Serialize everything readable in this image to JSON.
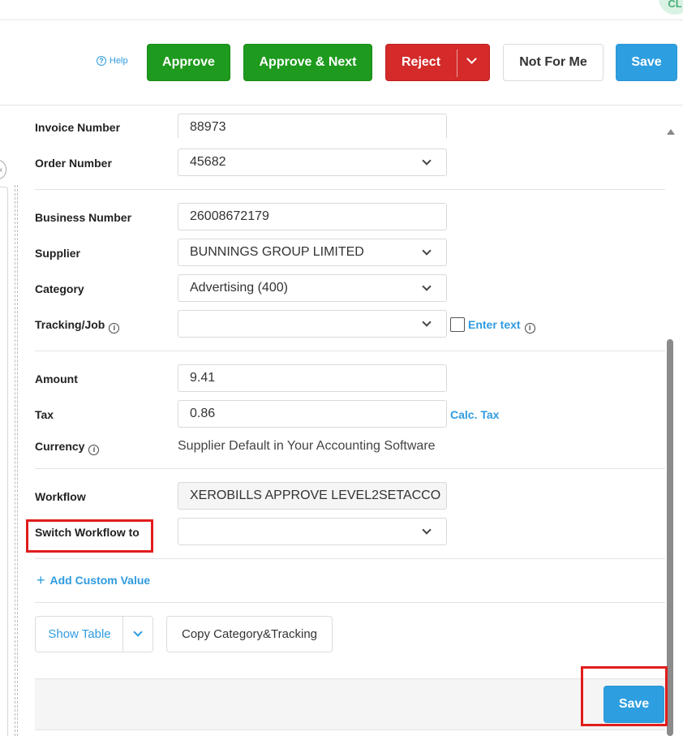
{
  "header": {
    "avatar_initials": "CL"
  },
  "toolbar": {
    "help_label": "Help",
    "approve_label": "Approve",
    "approve_next_label": "Approve & Next",
    "reject_label": "Reject",
    "not_for_me_label": "Not For Me",
    "save_label": "Save"
  },
  "form": {
    "invoice_number": {
      "label": "Invoice Number",
      "value": "88973"
    },
    "order_number": {
      "label": "Order Number",
      "value": "45682"
    },
    "business_number": {
      "label": "Business Number",
      "value": "26008672179"
    },
    "supplier": {
      "label": "Supplier",
      "value": "BUNNINGS GROUP LIMITED"
    },
    "category": {
      "label": "Category",
      "value": "Advertising (400)"
    },
    "tracking": {
      "label": "Tracking/Job",
      "value": "",
      "enter_text_label": "Enter text"
    },
    "amount": {
      "label": "Amount",
      "value": "9.41"
    },
    "tax": {
      "label": "Tax",
      "value": "0.86",
      "calc_label": "Calc. Tax"
    },
    "currency": {
      "label": "Currency",
      "value": "Supplier Default in Your Accounting Software"
    },
    "workflow": {
      "label": "Workflow",
      "value": "XEROBILLS APPROVE LEVEL2SETACCO"
    },
    "switch_workflow": {
      "label": "Switch Workflow to",
      "value": ""
    },
    "add_custom_value_label": "Add Custom Value",
    "show_table_label": "Show Table",
    "copy_category_label": "Copy Category&Tracking",
    "save_label": "Save"
  },
  "colors": {
    "green": "#1e9a1e",
    "red": "#d42a2a",
    "blue": "#2d9ee0",
    "highlight": "#e11c1c"
  }
}
